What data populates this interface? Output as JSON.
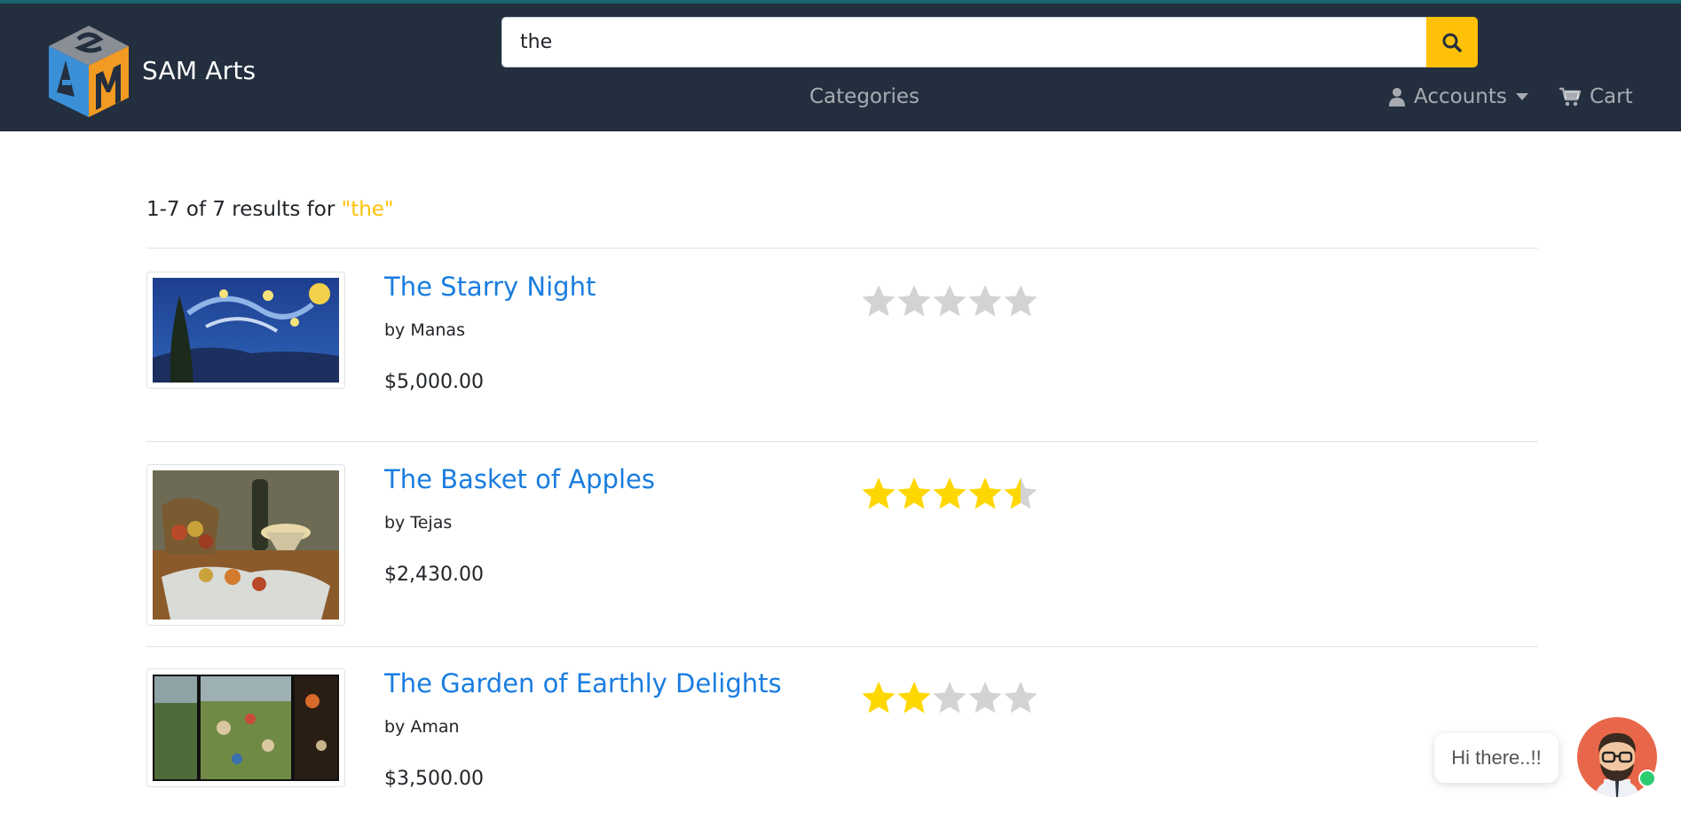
{
  "brand": {
    "name": "SAM Arts",
    "logo_text": "SAM"
  },
  "search": {
    "value": "the",
    "icon": "search-icon"
  },
  "nav": {
    "categories_label": "Categories",
    "accounts_label": "Accounts",
    "cart_label": "Cart"
  },
  "results": {
    "summary_prefix": "1-7 of 7 results for ",
    "query_display": "\"the\"",
    "items": [
      {
        "title": "The Starry Night",
        "artist": "by Manas",
        "price": "$5,000.00",
        "rating": 0
      },
      {
        "title": "The Basket of Apples",
        "artist": "by Tejas",
        "price": "$2,430.00",
        "rating": 4.5
      },
      {
        "title": "The Garden of Earthly Delights",
        "artist": "by Aman",
        "price": "$3,500.00",
        "rating": 2
      }
    ]
  },
  "chat": {
    "greeting": "Hi there..!!"
  },
  "colors": {
    "navbar_bg": "#232f3e",
    "accent": "#ffc107",
    "link": "#1a7de0",
    "star_filled": "#ffd700",
    "star_empty": "#d3d3d3"
  }
}
